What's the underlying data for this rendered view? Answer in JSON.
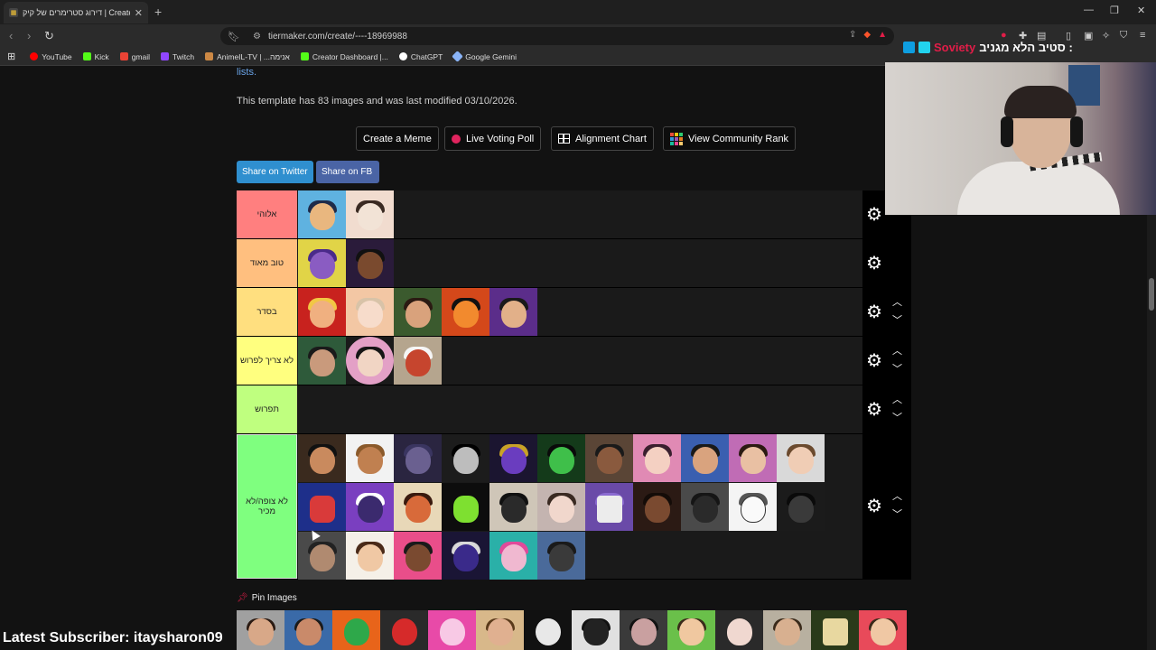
{
  "browser": {
    "tab_title": "דירוג סטרימרים של קיק | Create a",
    "tab_favicon": "tiermaker-favicon",
    "url": "tiermaker.com/create/----18969988",
    "bookmarks": [
      {
        "label": "YouTube",
        "color": "#ff0000"
      },
      {
        "label": "Kick",
        "color": "#53fc18"
      },
      {
        "label": "gmail",
        "color": "#ea4335"
      },
      {
        "label": "Twitch",
        "color": "#9146ff"
      },
      {
        "label": "AnimeIL-TV | ...אנימה",
        "color": "#cc8844"
      },
      {
        "label": "Creator Dashboard |...",
        "color": "#53fc18"
      },
      {
        "label": "ChatGPT",
        "color": "#ffffff"
      },
      {
        "label": "Google Gemini",
        "color": "#8ab4f8"
      }
    ]
  },
  "page": {
    "lists_link": "lists.",
    "template_info": "This template has 83 images and was last modified 03/10/2026.",
    "actions": {
      "meme": "Create a Meme",
      "poll": "Live Voting Poll",
      "alignment": "Alignment Chart",
      "community": "View Community Rank"
    },
    "share": {
      "twitter": "Share on Twitter",
      "fb": "Share on FB"
    },
    "pin_images": "Pin Images"
  },
  "tiers": [
    {
      "label": "אלוהי",
      "color": "#ff7f7f"
    },
    {
      "label": "טוב מאוד",
      "color": "#ffbf7f"
    },
    {
      "label": "בסדר",
      "color": "#ffdf7f"
    },
    {
      "label": "לא צריך לפרוש",
      "color": "#ffff7f"
    },
    {
      "label": "תפרוש",
      "color": "#bfff7f"
    },
    {
      "label": "לא צופה/לא מכיר",
      "color": "#7fff7f"
    }
  ],
  "overlay": {
    "cam_title_prefix": "סטיב הלא מגניב :",
    "cam_title_brand": "Soviety",
    "latest_subscriber": "Latest Subscriber: itaysharon09"
  }
}
